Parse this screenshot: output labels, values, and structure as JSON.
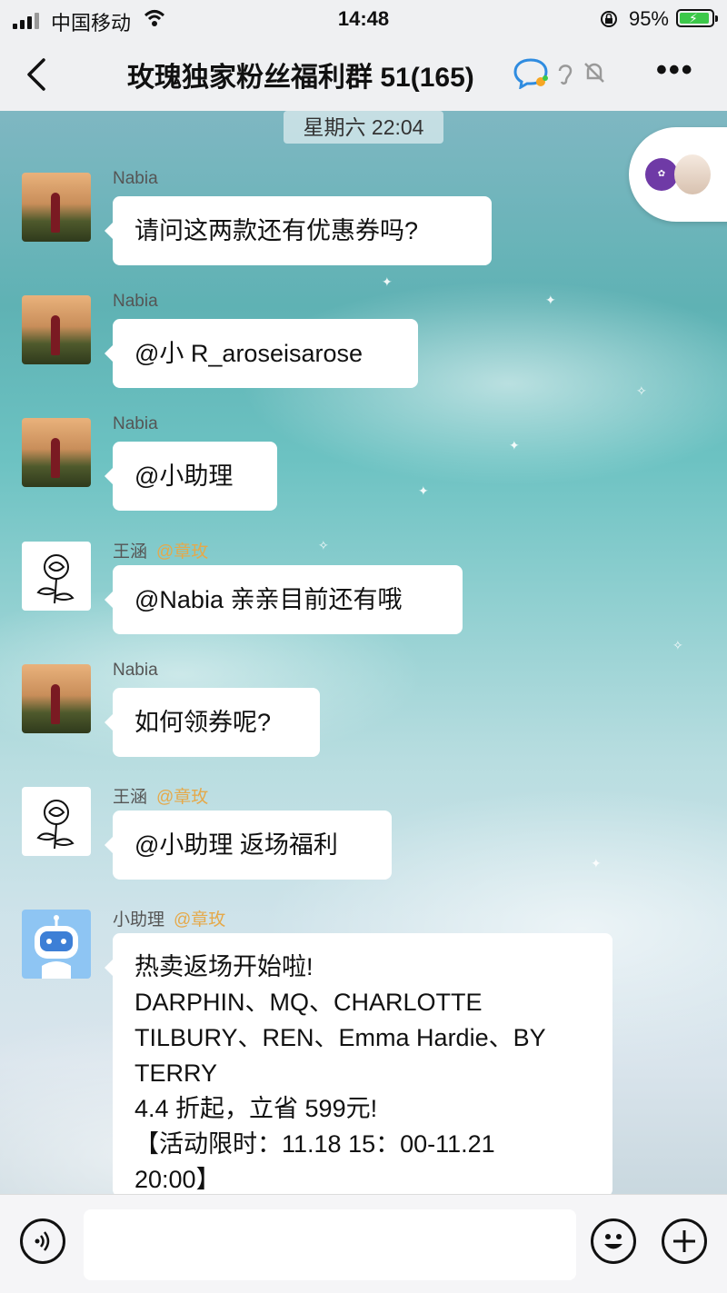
{
  "status_bar": {
    "carrier": "中国移动",
    "time": "14:48",
    "battery_percent": "95%"
  },
  "nav": {
    "title": "玫瑰独家粉丝福利群 51(165)"
  },
  "chat": {
    "timestamp": "星期六 22:04",
    "messages": [
      {
        "sender": "Nabia",
        "sender_tag": "",
        "text": "请问这两款还有优惠券吗?"
      },
      {
        "sender": "Nabia",
        "sender_tag": "",
        "text": "@小 R_aroseisarose"
      },
      {
        "sender": "Nabia",
        "sender_tag": "",
        "text": "@小助理"
      },
      {
        "sender": "王涵",
        "sender_tag": "@章玫",
        "text": "@Nabia 亲亲目前还有哦"
      },
      {
        "sender": "Nabia",
        "sender_tag": "",
        "text": "如何领券呢?"
      },
      {
        "sender": "王涵",
        "sender_tag": "@章玫",
        "text": "@小助理 返场福利"
      },
      {
        "sender": "小助理",
        "sender_tag": "@章玫",
        "lines": [
          "热卖返场开始啦!",
          "DARPHIN、MQ、CHARLOTTE",
          "TILBURY、REN、Emma Hardie、BY",
          " TERRY",
          "4.4 折起，立省 599元!",
          "【活动限时：11.18 15：00-11.21",
          "20:00】"
        ]
      }
    ]
  },
  "colors": {
    "mention": "#e5a94a",
    "battery_fill": "#3cc84a"
  },
  "icons": [
    "signal-icon",
    "wifi-icon",
    "lock-rotation-icon",
    "battery-icon",
    "back-icon",
    "chat-bubble-icon",
    "ear-icon",
    "mute-bell-icon",
    "more-icon",
    "voice-icon",
    "emoji-icon",
    "plus-icon"
  ]
}
